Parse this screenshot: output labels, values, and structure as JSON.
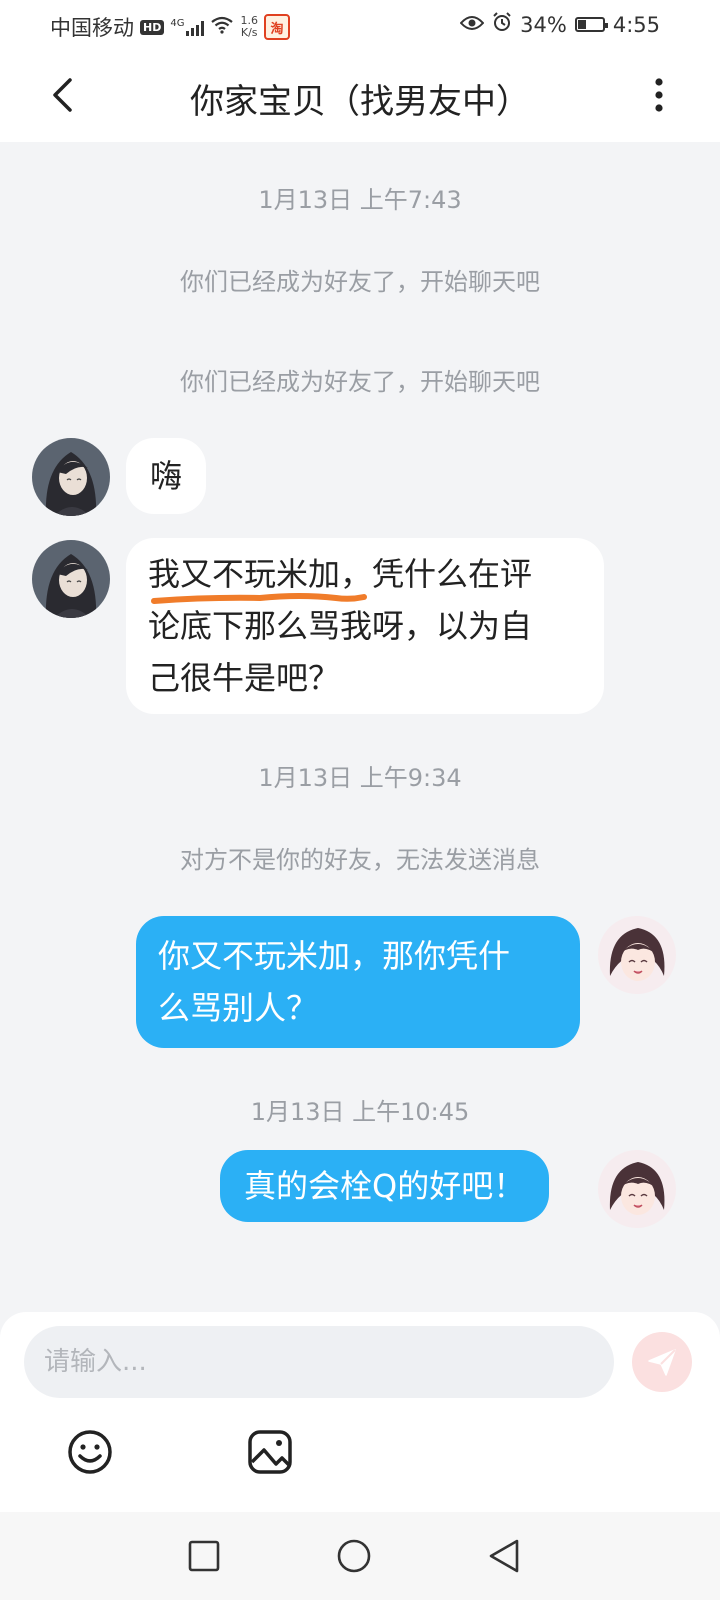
{
  "status_bar": {
    "carrier": "中国移动",
    "hd": "HD",
    "signal_gen": "4G",
    "net_speed_value": "1.6",
    "net_speed_unit": "K/s",
    "app_badge": "淘",
    "battery": "34%",
    "battery_level": 0.34,
    "time": "4:55"
  },
  "header": {
    "title": "你家宝贝（找男友中）"
  },
  "chat": {
    "timestamps": [
      "1月13日 上午7:43",
      "1月13日 上午9:34",
      "1月13日 上午10:45"
    ],
    "system_messages": [
      "你们已经成为好友了，开始聊天吧",
      "你们已经成为好友了，开始聊天吧",
      "对方不是你的好友，无法发送消息"
    ],
    "messages": [
      {
        "side": "in",
        "text": "嗨"
      },
      {
        "side": "in",
        "line1": "我又不玩米加，凭什么在评",
        "line2": "论底下那么骂我呀，以为自",
        "line3": "己很牛是吧？"
      },
      {
        "side": "out",
        "line1": "你又不玩米加，那你凭什",
        "line2": "么骂别人？"
      },
      {
        "side": "out",
        "text": "真的会栓Q的好吧！"
      }
    ]
  },
  "input": {
    "placeholder": "请输入..."
  },
  "icons": {
    "back": "back-arrow-icon",
    "more": "more-vertical-icon",
    "send": "send-icon",
    "emoji": "emoji-icon",
    "image": "image-icon",
    "nav_recent": "square-icon",
    "nav_home": "circle-icon",
    "nav_back": "triangle-icon"
  },
  "colors": {
    "outgoing_bubble": "#2bb0f5",
    "incoming_bubble": "#ffffff",
    "background": "#f3f4f6",
    "send_button": "#fbe0e0",
    "underline": "#f07c2a"
  }
}
